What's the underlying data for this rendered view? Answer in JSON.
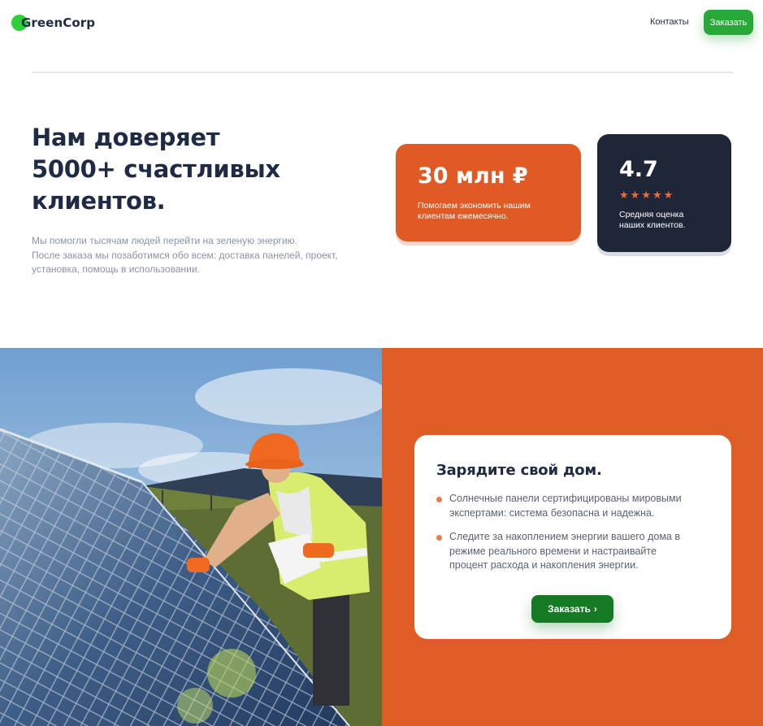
{
  "header": {
    "logo_text": "GreenCorp",
    "nav_contacts": "Контакты",
    "order_label": "Заказать"
  },
  "trust": {
    "title_line1": "Нам доверяет",
    "title_line2": "5000+ счастливых",
    "title_line3": "клиентов.",
    "desc_line1": "Мы помогли тысячам людей перейти на зеленую энергию.",
    "desc_line2": "После заказа мы позаботимся обо всем: доставка панелей, проект,",
    "desc_line3": "установка, помощь в использовании.",
    "stats": [
      {
        "value": "30 млн ₽",
        "caption_line1": "Помогаем экономить нашим",
        "caption_line2": "клиентам ежемесячно."
      },
      {
        "value": "4.7",
        "rating": 5,
        "caption_line1": "Средняя оценка",
        "caption_line2": "наших клиентов."
      }
    ]
  },
  "promo": {
    "title": "Зарядите свой дом.",
    "items": [
      {
        "line1": "Солнечные панели сертифицированы мировыми",
        "line2": "экспертами: система безопасна и надежна."
      },
      {
        "line1": "Следите за накоплением энергии вашего дома в",
        "line2": "режиме реального времени и настраивайте",
        "line3": "процент расхода и накопления энергии."
      }
    ],
    "order_label": "Заказать",
    "chevron_icon": "chevron-right-icon"
  },
  "colors": {
    "accent_green": "#28a836",
    "dark_green": "#157a23",
    "orange": "#e05a25",
    "navy": "#1f2638"
  }
}
